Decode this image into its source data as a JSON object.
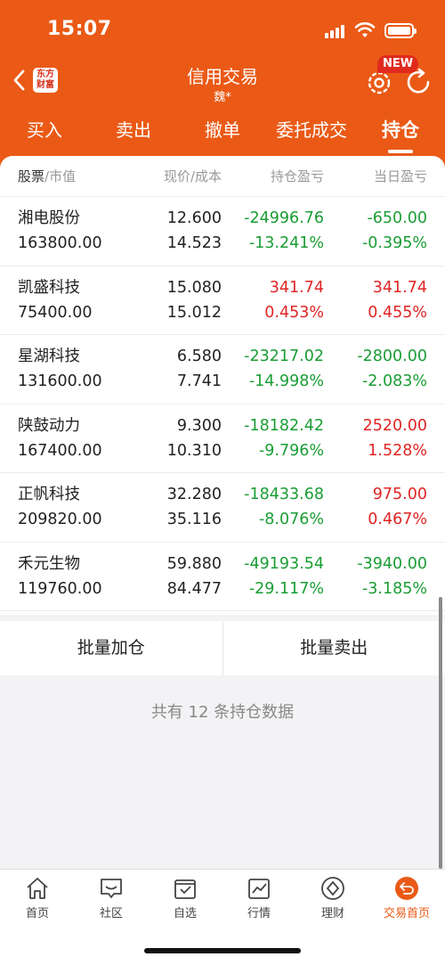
{
  "status_bar": {
    "time": "15:07"
  },
  "nav": {
    "title": "信用交易",
    "account": "魏*",
    "logo_text": "东方财富",
    "new_badge": "NEW"
  },
  "tabs": [
    {
      "label": "买入",
      "active": false
    },
    {
      "label": "卖出",
      "active": false
    },
    {
      "label": "撤单",
      "active": false
    },
    {
      "label": "委托成交",
      "active": false
    },
    {
      "label": "持仓",
      "active": true
    }
  ],
  "table": {
    "headers": {
      "stock": "股票",
      "market_value": "/市值",
      "price_cost": "现价/成本",
      "position_pl": "持仓盈亏",
      "daily_pl": "当日盈亏"
    },
    "rows": [
      {
        "name": "湘电股份",
        "market_value": "163800.00",
        "price": "12.600",
        "cost": "14.523",
        "pl": "-24996.76",
        "pl_pct": "-13.241%",
        "daily_pl": "-650.00",
        "daily_pl_pct": "-0.395%"
      },
      {
        "name": "凯盛科技",
        "market_value": "75400.00",
        "price": "15.080",
        "cost": "15.012",
        "pl": "341.74",
        "pl_pct": "0.453%",
        "daily_pl": "341.74",
        "daily_pl_pct": "0.455%"
      },
      {
        "name": "星湖科技",
        "market_value": "131600.00",
        "price": "6.580",
        "cost": "7.741",
        "pl": "-23217.02",
        "pl_pct": "-14.998%",
        "daily_pl": "-2800.00",
        "daily_pl_pct": "-2.083%"
      },
      {
        "name": "陕鼓动力",
        "market_value": "167400.00",
        "price": "9.300",
        "cost": "10.310",
        "pl": "-18182.42",
        "pl_pct": "-9.796%",
        "daily_pl": "2520.00",
        "daily_pl_pct": "1.528%"
      },
      {
        "name": "正帆科技",
        "market_value": "209820.00",
        "price": "32.280",
        "cost": "35.116",
        "pl": "-18433.68",
        "pl_pct": "-8.076%",
        "daily_pl": "975.00",
        "daily_pl_pct": "0.467%"
      },
      {
        "name": "禾元生物",
        "market_value": "119760.00",
        "price": "59.880",
        "cost": "84.477",
        "pl": "-49193.54",
        "pl_pct": "-29.117%",
        "daily_pl": "-3940.00",
        "daily_pl_pct": "-3.185%"
      }
    ]
  },
  "actions": {
    "batch_add": "批量加仓",
    "batch_sell": "批量卖出"
  },
  "summary": "共有 12 条持仓数据",
  "bottom_nav": [
    {
      "label": "首页",
      "icon": "home-icon"
    },
    {
      "label": "社区",
      "icon": "chat-icon"
    },
    {
      "label": "自选",
      "icon": "watchlist-icon"
    },
    {
      "label": "行情",
      "icon": "market-chart-icon"
    },
    {
      "label": "理财",
      "icon": "finance-diamond-icon"
    },
    {
      "label": "交易首页",
      "icon": "trade-home-icon",
      "active": true
    }
  ],
  "colors": {
    "brand": "#ea5a16",
    "gain": "#e02424",
    "loss": "#1a9d34"
  }
}
